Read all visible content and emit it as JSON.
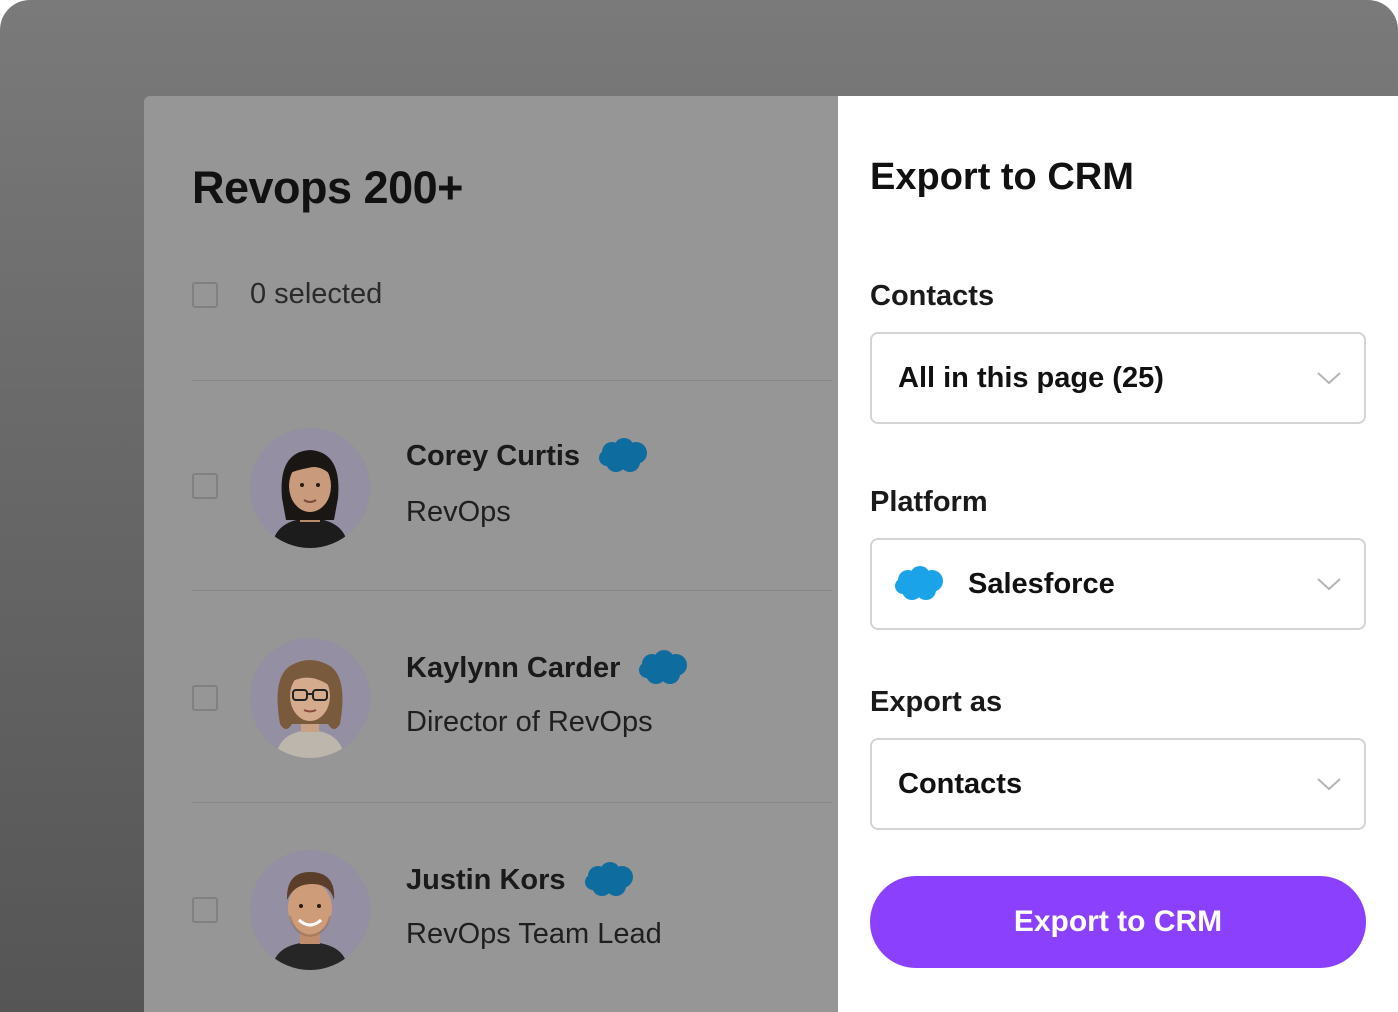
{
  "list": {
    "title": "Revops 200+",
    "selected_label": "0 selected",
    "contacts": [
      {
        "name": "Corey Curtis",
        "title": "RevOps",
        "crm_icon": "salesforce-icon"
      },
      {
        "name": "Kaylynn Carder",
        "title": "Director of RevOps",
        "crm_icon": "salesforce-icon"
      },
      {
        "name": "Justin Kors",
        "title": "RevOps Team Lead",
        "crm_icon": "salesforce-icon"
      }
    ]
  },
  "export_panel": {
    "title": "Export to CRM",
    "contacts_label": "Contacts",
    "contacts_value": "All in this page (25)",
    "platform_label": "Platform",
    "platform_value": "Salesforce",
    "platform_icon": "salesforce-icon",
    "export_as_label": "Export as",
    "export_as_value": "Contacts",
    "submit_label": "Export to CRM"
  },
  "colors": {
    "accent": "#8a40fd",
    "salesforce_blue": "#1aa3e8",
    "salesforce_dimmed": "#0e6c9e",
    "overlay_panel": "#969696"
  }
}
